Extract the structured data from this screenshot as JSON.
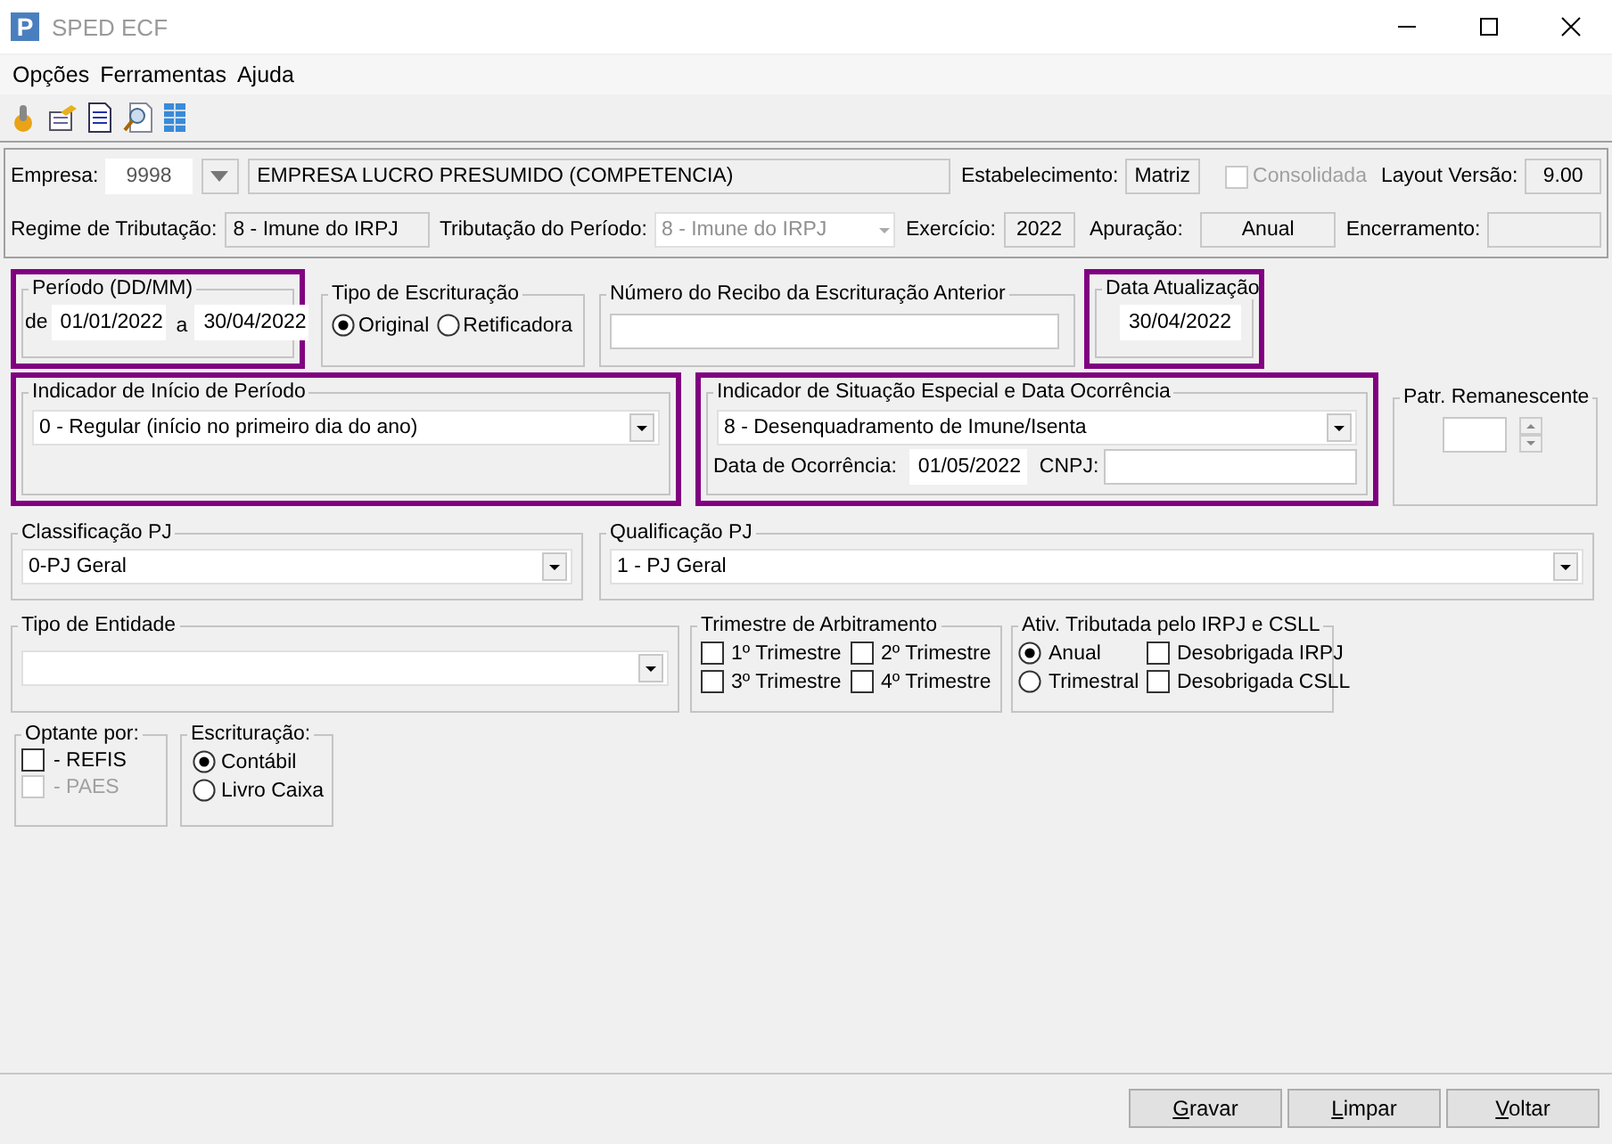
{
  "window": {
    "logo": "P",
    "title": "SPED ECF"
  },
  "menu": [
    "Opções",
    "Ferramentas",
    "Ajuda"
  ],
  "header": {
    "empresa": {
      "label": "Empresa:",
      "code": "9998",
      "name": "EMPRESA LUCRO PRESUMIDO (COMPETENCIA)"
    },
    "estabelecimento": {
      "label": "Estabelecimento:",
      "value": "Matriz"
    },
    "consolidada": {
      "label": "Consolidada",
      "checked": false,
      "disabled": true
    },
    "layout_versao": {
      "label": "Layout Versão:",
      "value": "9.00"
    },
    "regime": {
      "label": "Regime de Tributação:",
      "value": "8 - Imune do IRPJ"
    },
    "tributacao_periodo": {
      "label": "Tributação do Período:",
      "value": "8 - Imune do IRPJ",
      "disabled": true
    },
    "exercicio": {
      "label": "Exercício:",
      "value": "2022"
    },
    "apuracao": {
      "label": "Apuração:",
      "value": "Anual"
    },
    "encerramento": {
      "label": "Encerramento:"
    }
  },
  "periodo": {
    "title": "Período (DD/MM)",
    "highlighted": true,
    "from_label": "de",
    "from": "01/01/2022",
    "to_label": "a",
    "to": "30/04/2022"
  },
  "tipo_escrituracao": {
    "title": "Tipo de Escrituração",
    "highlighted": false,
    "options": [
      {
        "label": "Original",
        "selected": true
      },
      {
        "label": "Retificadora",
        "selected": false
      }
    ]
  },
  "numero_recibo": {
    "title": "Número do Recibo da Escrituração Anterior",
    "highlighted": false
  },
  "data_atualizacao": {
    "title": "Data Atualização",
    "value": "30/04/2022",
    "highlighted": true
  },
  "indicador_inicio": {
    "title": "Indicador de Início de Período",
    "value": "0 - Regular (início no primeiro dia do ano)",
    "highlighted": true
  },
  "indicador_situacao": {
    "title": "Indicador de Situação Especial e Data Ocorrência",
    "value": "8 - Desenquadramento de Imune/Isenta",
    "date_label": "Data de Ocorrência:",
    "date": "01/05/2022",
    "cnpj_label": "CNPJ:",
    "highlighted": true
  },
  "patr_remanescente": {
    "title": "Patr. Remanescente",
    "highlighted": false
  },
  "classificacao_pj": {
    "title": "Classificação PJ",
    "value": "0-PJ Geral"
  },
  "qualificacao_pj": {
    "title": "Qualificação PJ",
    "value": "1 - PJ Geral"
  },
  "tipo_entidade": {
    "title": "Tipo de Entidade"
  },
  "trimestre_arbitramento": {
    "title": "Trimestre de Arbitramento",
    "options": [
      {
        "label": "1º Trimestre",
        "checked": false
      },
      {
        "label": "2º Trimestre",
        "checked": false
      },
      {
        "label": "3º Trimestre",
        "checked": false
      },
      {
        "label": "4º Trimestre",
        "checked": false
      }
    ]
  },
  "ativ_tributada": {
    "title": "Ativ. Tributada pelo IRPJ e CSLL",
    "radios": [
      {
        "label": "Anual",
        "selected": true
      },
      {
        "label": "Trimestral",
        "selected": false
      }
    ],
    "checks": [
      {
        "label": "Desobrigada IRPJ",
        "checked": false
      },
      {
        "label": "Desobrigada CSLL",
        "checked": false
      }
    ]
  },
  "optante": {
    "title": "Optante por:",
    "options": [
      {
        "label": "- REFIS",
        "checked": false,
        "disabled": false
      },
      {
        "label": "- PAES",
        "checked": false,
        "disabled": true
      }
    ]
  },
  "escrituracao": {
    "title": "Escrituração:",
    "options": [
      {
        "label": "Contábil",
        "selected": true
      },
      {
        "label": "Livro Caixa",
        "selected": false
      }
    ]
  },
  "buttons": [
    "Gravar",
    "Limpar",
    "Voltar"
  ]
}
